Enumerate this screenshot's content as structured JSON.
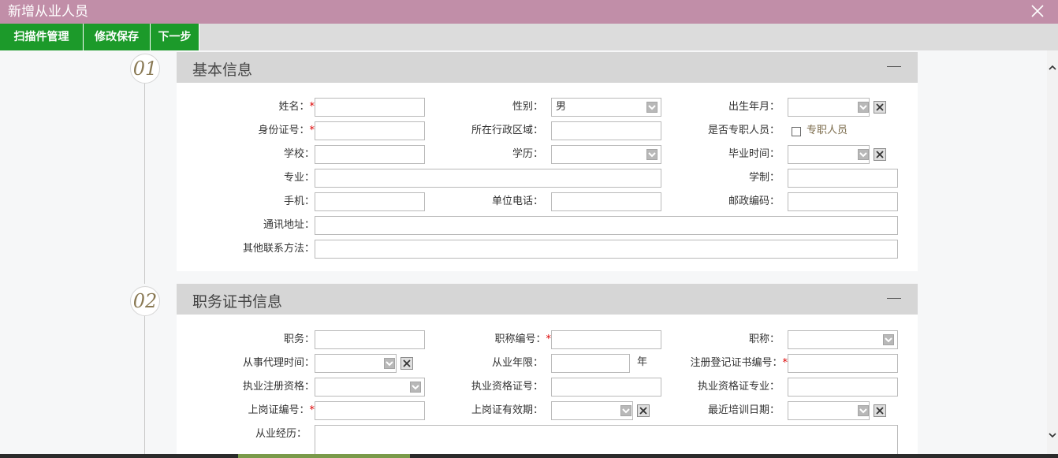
{
  "window": {
    "title": "新增从业人员"
  },
  "toolbar": {
    "buttons": [
      "扫描件管理",
      "修改保存",
      "下一步"
    ]
  },
  "section1": {
    "number": "01",
    "title": "基本信息",
    "fields": {
      "name": "姓名：",
      "gender": "性别：",
      "birth": "出生年月：",
      "idcard": "身份证号：",
      "region": "所在行政区域：",
      "fulltime": "是否专职人员：",
      "fulltime_option": "专职人员",
      "school": "学校：",
      "education": "学历：",
      "grad_time": "毕业时间：",
      "major": "专业：",
      "study_length": "学制：",
      "mobile": "手机：",
      "work_phone": "单位电话：",
      "postcode": "邮政编码：",
      "address": "通讯地址：",
      "other_contact": "其他联系方法："
    },
    "values": {
      "gender": "男"
    }
  },
  "section2": {
    "number": "02",
    "title": "职务证书信息",
    "fields": {
      "position": "职务：",
      "title_no": "职称编号：",
      "title": "职称：",
      "agent_time": "从事代理时间：",
      "work_years": "从业年限：",
      "years_unit": "年",
      "reg_cert_no": "注册登记证书编号：",
      "practice_qual": "执业注册资格：",
      "qual_cert_no": "执业资格证号：",
      "qual_major": "执业资格证专业：",
      "post_cert_no": "上岗证编号：",
      "post_cert_valid": "上岗证有效期：",
      "training_date": "最近培训日期：",
      "experience": "从业经历："
    }
  },
  "required_mark": "*",
  "icons": {
    "close": "close-icon",
    "dropdown": "chevron-down-icon",
    "clear": "clear-x-icon",
    "collapse": "minus-icon",
    "scroll_up": "chevron-up-icon",
    "scroll_down": "chevron-down-icon"
  },
  "colors": {
    "titlebar": "#c18ea8",
    "toolbar_button": "#1c9a2a",
    "panel_header": "#d6d6d6",
    "required": "#dd0000"
  }
}
